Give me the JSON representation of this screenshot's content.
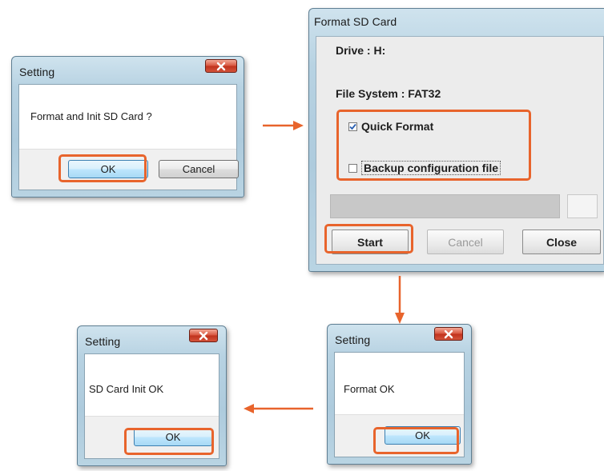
{
  "dialogs": {
    "confirm": {
      "title": "Setting",
      "message": "Format and Init SD Card ?",
      "ok_label": "OK",
      "cancel_label": "Cancel"
    },
    "format": {
      "title": "Format SD Card",
      "drive_label": "Drive : H:",
      "filesystem_label": "File System : FAT32",
      "quick_format_label": "Quick Format",
      "quick_format_checked": true,
      "backup_label": "Backup configuration file",
      "backup_checked": false,
      "progress": 0,
      "start_label": "Start",
      "cancel_label": "Cancel",
      "close_label": "Close"
    },
    "format_ok": {
      "title": "Setting",
      "message": "Format OK",
      "ok_label": "OK"
    },
    "init_ok": {
      "title": "Setting",
      "message": "SD Card Init OK",
      "ok_label": "OK"
    }
  },
  "colors": {
    "highlight": "#e8642c",
    "arrow": "#e8642c",
    "close_button": "#c8402a"
  },
  "icons": {
    "close": "close-x-icon",
    "checkbox_checked": "checkmark-icon",
    "flow_arrow": "arrow-icon"
  }
}
